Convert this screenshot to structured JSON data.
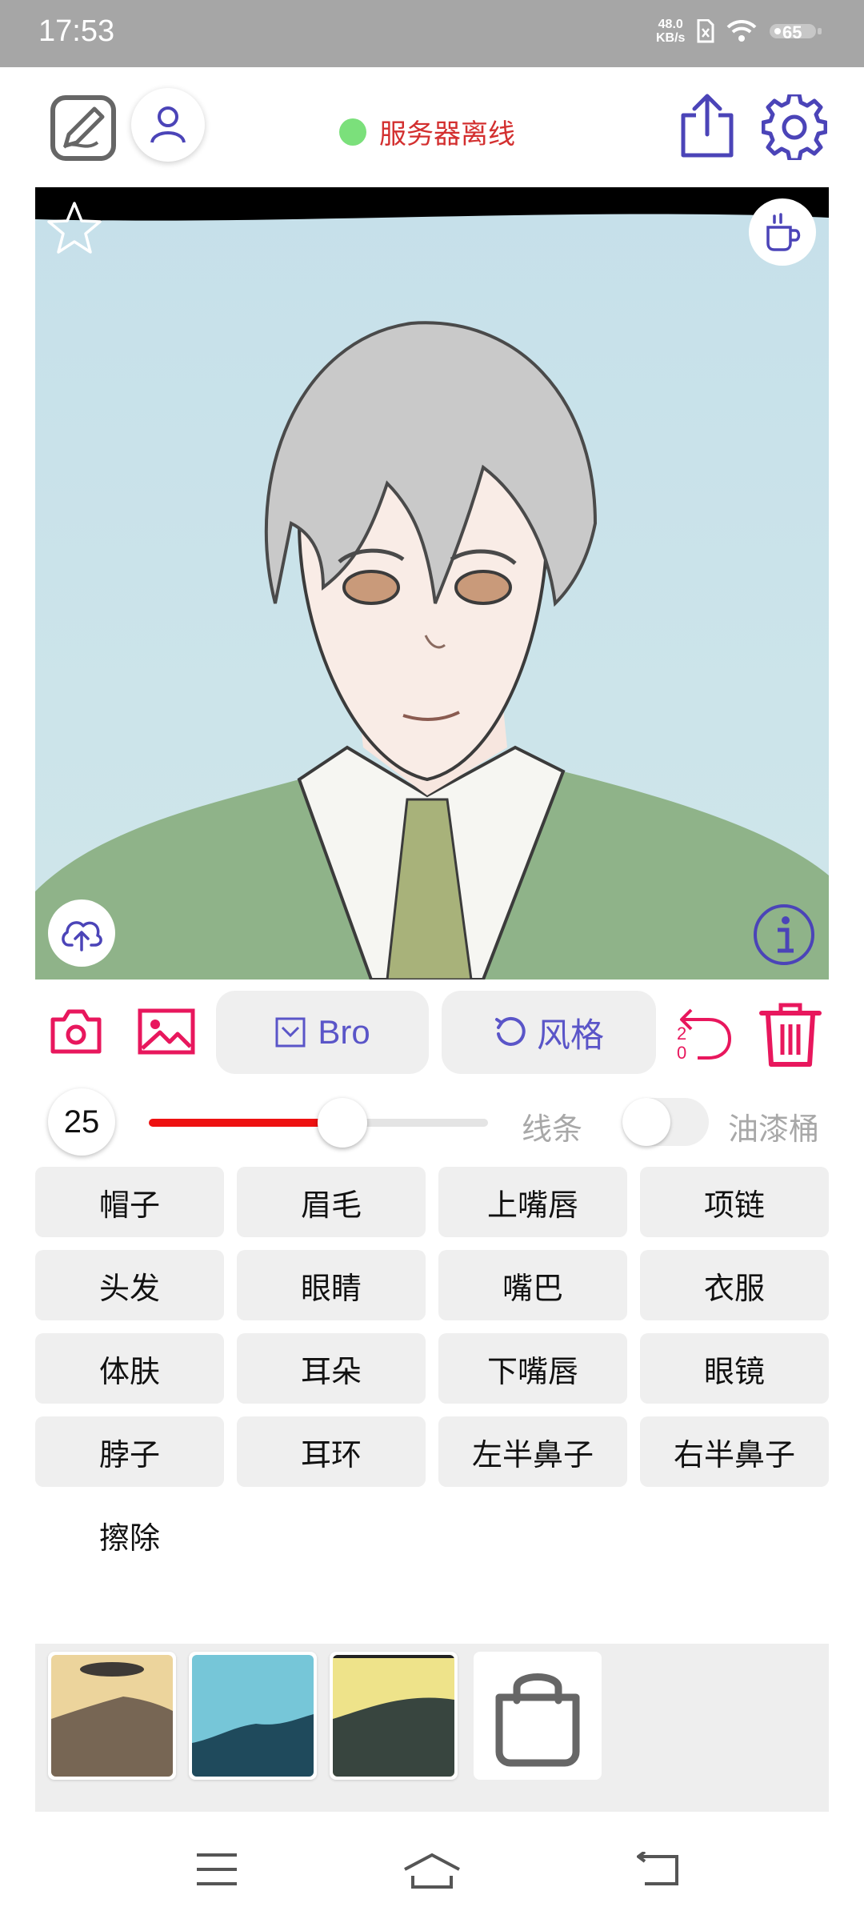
{
  "status_bar": {
    "time": "17:53",
    "net_speed": "48.0",
    "net_unit": "KB/s",
    "battery": "65"
  },
  "header": {
    "server_status": "服务器离线",
    "status_color": "#7be07b"
  },
  "toolbar": {
    "bro_label": "Bro",
    "style_label": "风格",
    "undo_count": "20"
  },
  "slider": {
    "brush_size": "25",
    "value_fraction": 0.57,
    "line_label": "线条",
    "bucket_label": "油漆桶",
    "bucket_enabled": false
  },
  "parts": {
    "items": [
      {
        "label": "帽子"
      },
      {
        "label": "眉毛"
      },
      {
        "label": "上嘴唇"
      },
      {
        "label": "项链"
      },
      {
        "label": "头发"
      },
      {
        "label": "眼睛"
      },
      {
        "label": "嘴巴"
      },
      {
        "label": "衣服"
      },
      {
        "label": "体肤"
      },
      {
        "label": "耳朵"
      },
      {
        "label": "下嘴唇"
      },
      {
        "label": "眼镜"
      },
      {
        "label": "脖子"
      },
      {
        "label": "耳环"
      },
      {
        "label": "左半鼻子"
      },
      {
        "label": "右半鼻子"
      },
      {
        "label": "擦除"
      }
    ]
  },
  "colors": {
    "accent_red": "#e8175d",
    "accent_purple": "#4b44b8",
    "status_offline_text": "#d32f2f"
  }
}
